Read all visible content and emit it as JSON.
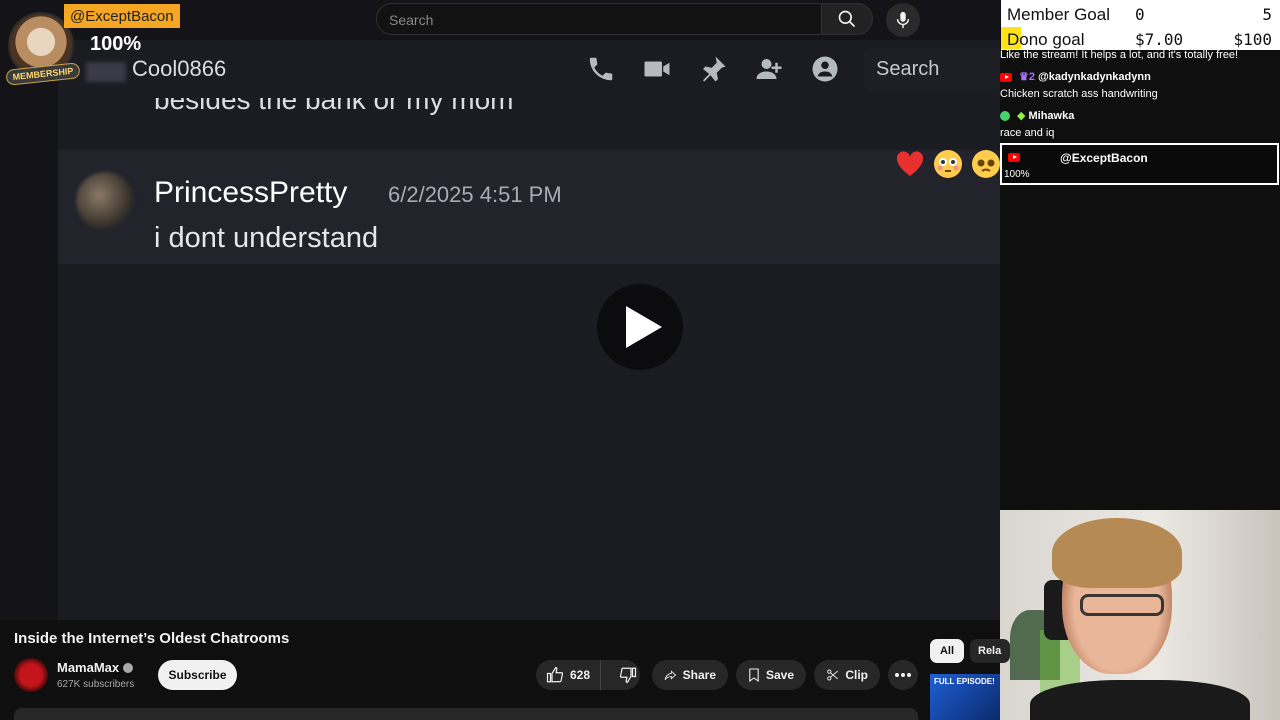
{
  "topbar": {
    "search_placeholder": "Search"
  },
  "membership_alert": {
    "username": "@ExceptBacon",
    "percent": "100%",
    "badge": "MEMBERSHIP"
  },
  "video_content": {
    "discord_header": {
      "channel_user": "Cool0866",
      "search_label": "Search"
    },
    "cut_off_line": "besides the bank or my mom",
    "message": {
      "author": "PrincessPretty",
      "timestamp": "6/2/2025 4:51 PM",
      "text": "i dont understand"
    }
  },
  "goals": {
    "member_goal": {
      "label": "Member Goal",
      "value": "0",
      "target": "5"
    },
    "dono_goal": {
      "label": "Dono goal",
      "value": "$7.00",
      "target": "$100",
      "progress": 0.07
    }
  },
  "chat": {
    "lines": [
      {
        "text": "Like the stream! It helps a lot, and it's totally free!"
      },
      {
        "user": "@kadynkadynkadynn",
        "badge": "♛2"
      },
      {
        "text": "Chicken scratch ass handwriting"
      },
      {
        "user": "Mihawka"
      },
      {
        "text": "race and iq"
      }
    ],
    "alert": {
      "user": "@ExceptBacon",
      "percent": "100%"
    }
  },
  "video_info": {
    "title": "Inside the Internet’s Oldest Chatrooms",
    "channel": "MamaMax",
    "subscribers": "627K subscribers",
    "subscribe_label": "Subscribe",
    "likes": "628",
    "share_label": "Share",
    "save_label": "Save",
    "clip_label": "Clip"
  },
  "related": {
    "chip_all": "All",
    "chip_related": "Rela",
    "thumb_text": "FULL EPISODE!"
  },
  "colors": {
    "yt_red": "#ff0000",
    "goal_yellow": "#ffe21a",
    "member_orange": "#f5a623"
  }
}
